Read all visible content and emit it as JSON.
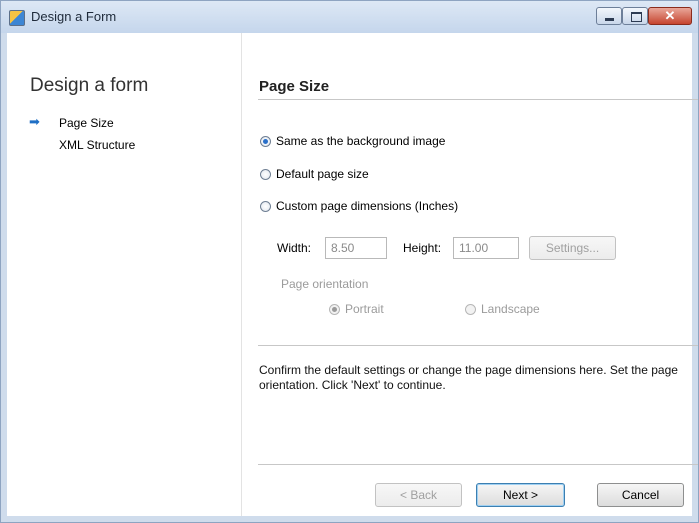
{
  "window": {
    "title": "Design a Form"
  },
  "sidebar": {
    "title": "Design a form",
    "items": [
      {
        "label": "Page Size",
        "current": true
      },
      {
        "label": "XML Structure",
        "current": false
      }
    ]
  },
  "main": {
    "title": "Page Size",
    "options": [
      {
        "label": "Same as the background image",
        "selected": true
      },
      {
        "label": "Default page size",
        "selected": false
      },
      {
        "label": "Custom page dimensions (Inches)",
        "selected": false
      }
    ],
    "width": {
      "label": "Width:",
      "value": "8.50"
    },
    "height": {
      "label": "Height:",
      "value": "11.00"
    },
    "settings_button": "Settings...",
    "orientation": {
      "label": "Page orientation",
      "portrait": "Portrait",
      "landscape": "Landscape",
      "selected": "Portrait"
    },
    "help_text": "Confirm the default settings or change the page dimensions here. Set the page orientation. Click 'Next' to continue."
  },
  "buttons": {
    "back": "< Back",
    "next": "Next >",
    "cancel": "Cancel"
  },
  "colors": {
    "accent": "#2a6fc9",
    "titlebar": "#c5d6ec"
  }
}
